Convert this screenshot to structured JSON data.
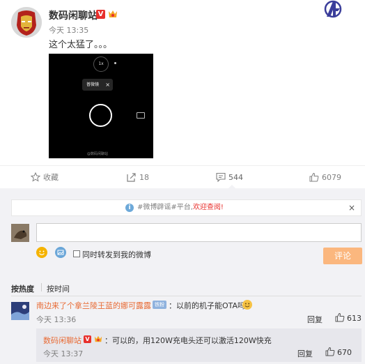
{
  "post": {
    "author": "数码闲聊站",
    "vip_badge": "V",
    "time": "今天 13:35",
    "text": "这个太猛了。。。",
    "media": {
      "zoom_label": "1x",
      "filter_chip": "普微镜",
      "filter_close": "×",
      "watermark": "@数码闲聊站"
    }
  },
  "actions": {
    "favorite": "收藏",
    "share_count": "18",
    "comment_count": "544",
    "like_count": "6079"
  },
  "comments_section": {
    "notice_prefix": "#微博辟谣#平台,",
    "notice_link": "欢迎查阅!",
    "notice_close": "×",
    "input_value": "",
    "repost_label": "同时转发到我的微博",
    "submit_label": "评论",
    "sort_hot": "按热度",
    "sort_time": "按时间",
    "comments": [
      {
        "user": "南边来了个拿兰陵王蓝的娜可露露",
        "fan_label": "铁粉",
        "text": "：以前的机子能OTA吗",
        "time": "今天 13:36",
        "reply_label": "回复",
        "likes": "613",
        "replies": [
          {
            "user": "数码闲聊站",
            "vip_badge": "V",
            "text": "：可以的，用120W充电头还可以激活120W快充",
            "time": "今天 13:37",
            "reply_label": "回复",
            "likes": "670"
          }
        ]
      }
    ]
  },
  "colors": {
    "accent_orange": "#e86b35",
    "vip_red": "#e8302d",
    "submit_bg": "#fbb77e",
    "panel_bg": "#f2f2f5"
  }
}
